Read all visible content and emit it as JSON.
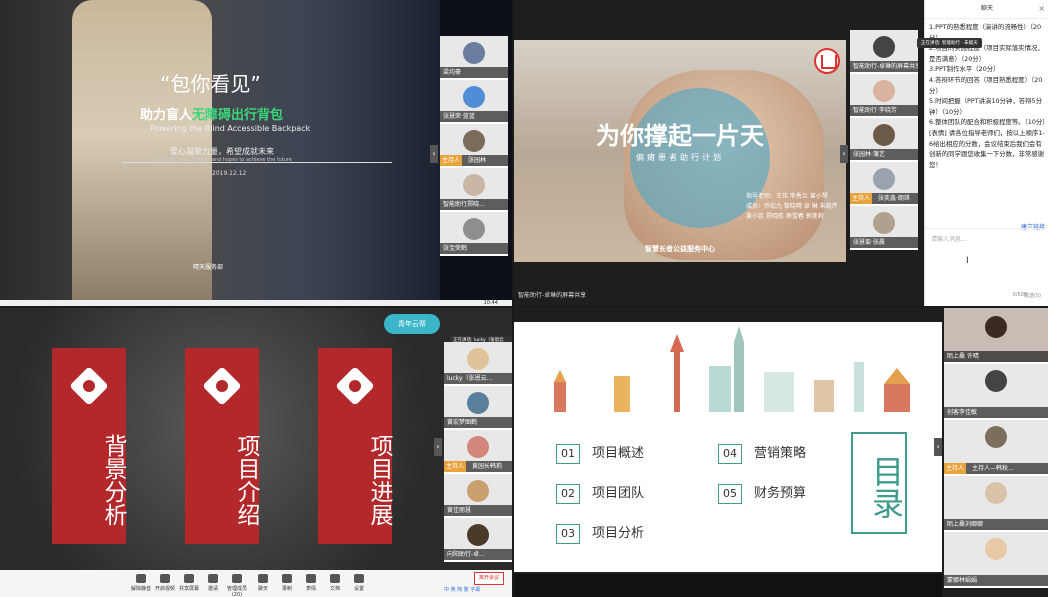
{
  "q1": {
    "slide": {
      "title": "“包你看见”",
      "subtitle_pre": "助力盲人",
      "subtitle_highlight": "无障碍出行背包",
      "english": "Powering the Blind Accessible Backpack",
      "slogan": "爱心凝聚力量，希望成就未来",
      "slogan_en": "Love gathers strength and hopes to achieve the future",
      "date": "2019.12.12",
      "brand": "晴天服务部"
    },
    "participants": [
      {
        "name": "梁均豪",
        "host": false
      },
      {
        "name": "张慧荣·蓝蓝",
        "host": false
      },
      {
        "name": "张园林",
        "host": true,
        "host_label": "主持人"
      },
      {
        "name": "智能助行郑晓…",
        "host": false
      },
      {
        "name": "张宝荣鹤",
        "host": false
      }
    ],
    "time": "10:44"
  },
  "q2": {
    "slide": {
      "title": "为你撑起一片天",
      "subtitle": "偏瘫患者助行计划",
      "credits": [
        "指导老师：王伟 李秀兰 曾小琴",
        "成员：乔宏九 黎晓晴 卓 琳 朱晓芹",
        "黄小蕊 郑晓航 薛雪春 郭莲莉"
      ],
      "org": "智慧长者公益服务中心"
    },
    "participants": [
      {
        "name": "智能助行-卓琳的屏幕共享",
        "host": false
      },
      {
        "name": "智能助行·李晓芳",
        "host": false
      },
      {
        "name": "张园林·蒲艺",
        "host": false
      },
      {
        "name": "张奕鑫·朗琪",
        "host": true,
        "host_label": "主持人"
      },
      {
        "name": "张慧菊·张晨",
        "host": false
      }
    ],
    "share_label": "智能助行-卓琳的屏幕共享"
  },
  "chat": {
    "header": "聊天",
    "tooltip": "正在讲话: 智能助行 · 朱毓天",
    "messages": [
      "1.PPT的熟悉程度（演讲的流畅性）（20分）",
      "2.项目的实施程度（项目实际落实情况，是否满意）（20分）",
      "3.PPT制作水平（20分）",
      "4.答辩环节的回答（项目熟悉程度）（20分）",
      "5.时间把握（PPT讲演10分钟，答辩5分钟）（10分）",
      "6.整体团队的配合和积极程度等。（10分）",
      "[表情] 请各位指导老师们，按以上顺序1-6给出相应的分数，会议结束后我们会有创新的同学跟您收集一下分数，非常感谢您！"
    ],
    "link": "建立链接",
    "placeholder": "请输入消息...",
    "count": "0/500",
    "send": "发送(S)"
  },
  "q3": {
    "cards": [
      {
        "label": "背景分析"
      },
      {
        "label": "项目介绍"
      },
      {
        "label": "项目进展"
      }
    ],
    "cloud": "青年云帮",
    "speaking": "正在讲话: lucky（张恩云帮）",
    "participants": [
      {
        "name": "lucky（张恩云…",
        "host": false
      },
      {
        "name": "黄宏梦图鹤",
        "host": false
      },
      {
        "name": "黄园长韩莉",
        "host": true,
        "host_label": "主持人"
      },
      {
        "name": "黄佳丽慧",
        "host": false
      },
      {
        "name": "向阳助行-卓…",
        "host": false
      }
    ],
    "toolbar": [
      "解除静音",
      "开启视频",
      "共享屏幕",
      "邀请",
      "管理成员(20)",
      "聊天",
      "录制",
      "表情",
      "文档",
      "设置"
    ],
    "exit": "离开会议",
    "foot": "中 英 简 繁 字幕"
  },
  "q4": {
    "items": [
      {
        "num": "01",
        "label": "项目概述"
      },
      {
        "num": "02",
        "label": "项目团队"
      },
      {
        "num": "03",
        "label": "项目分析"
      },
      {
        "num": "04",
        "label": "营销策略"
      },
      {
        "num": "05",
        "label": "财务预算"
      }
    ],
    "mulu": "目录",
    "participants": [
      {
        "name": "陌上桑 许晴",
        "host": false
      },
      {
        "name": "创客李佳敏",
        "host": false
      },
      {
        "name": "主持人—韩秋…",
        "host": true,
        "host_label": "主持人"
      },
      {
        "name": "陌上桑刘卿卿",
        "host": false
      },
      {
        "name": "蒙娜林娟娟",
        "host": false
      }
    ]
  },
  "colors": {
    "accent_green": "#3bd67a",
    "red": "#b3282b",
    "teal": "#3f9b8a",
    "host": "#e8a33b"
  }
}
